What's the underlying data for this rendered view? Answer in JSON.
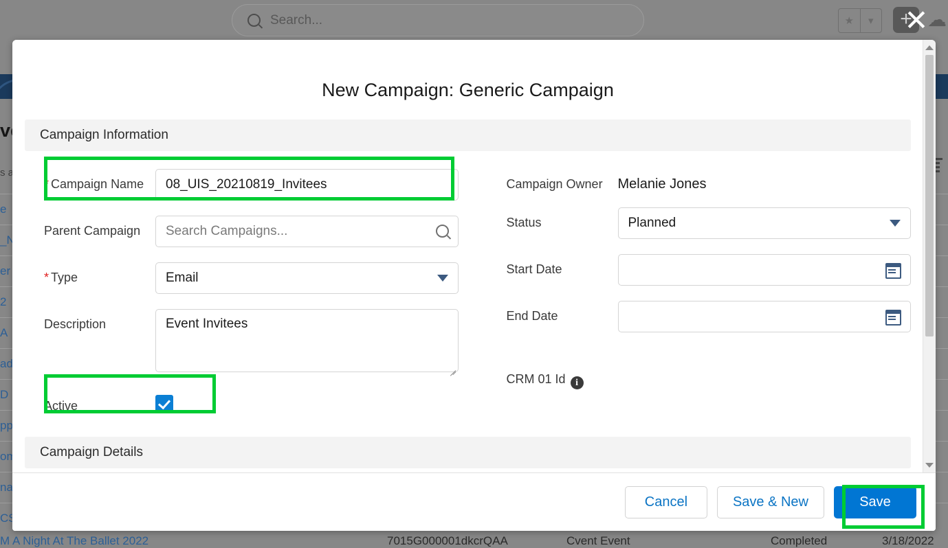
{
  "background": {
    "search": {
      "placeholder": "Search...",
      "icon": "search-icon"
    },
    "favorites": {
      "star_icon": "star-icon",
      "caret_icon": "chevron-down-icon"
    },
    "plus_icon": "plus-icon",
    "cloud_icon": "cloud-icon",
    "close_icon": "close-icon",
    "page_title_fragment": "ve",
    "subtitle_fragment": "s a",
    "row_fragments": [
      "e",
      "_N",
      "er",
      "2",
      "A",
      "ad",
      "D",
      "pp",
      "om",
      "na",
      "CS"
    ],
    "bottom_row": {
      "name": "M A Night At The Ballet 2022",
      "id": "7015G000001dkcrQAA",
      "type": "Cvent Event",
      "status": "Completed",
      "date": "3/18/2022"
    },
    "list_icon": "list-view-icon"
  },
  "modal": {
    "title": "New Campaign: Generic Campaign",
    "sections": [
      {
        "label": "Campaign Information"
      },
      {
        "label": "Campaign Details"
      }
    ],
    "fields": {
      "campaign_name": {
        "label": "Campaign Name",
        "required": true,
        "value": "08_UIS_20210819_Invitees",
        "placeholder": ""
      },
      "parent_campaign": {
        "label": "Parent Campaign",
        "required": false,
        "value": "",
        "placeholder": "Search Campaigns...",
        "icon": "search-icon"
      },
      "type": {
        "label": "Type",
        "required": true,
        "value": "Email",
        "icon": "chevron-down-icon"
      },
      "description": {
        "label": "Description",
        "required": false,
        "value": "Event Invitees",
        "placeholder": ""
      },
      "active": {
        "label": "Active",
        "checked": true
      },
      "campaign_owner": {
        "label": "Campaign Owner",
        "value": "Melanie Jones"
      },
      "status": {
        "label": "Status",
        "value": "Planned",
        "icon": "chevron-down-icon"
      },
      "start_date": {
        "label": "Start Date",
        "value": "",
        "placeholder": "",
        "icon": "calendar-icon"
      },
      "end_date": {
        "label": "End Date",
        "value": "",
        "placeholder": "",
        "icon": "calendar-icon"
      },
      "crm_01_id": {
        "label": "CRM 01 Id",
        "info_icon": "info-icon"
      }
    },
    "footer": {
      "cancel_label": "Cancel",
      "save_new_label": "Save & New",
      "save_label": "Save"
    },
    "scrollbar": {
      "up_icon": "scroll-up-arrow-icon",
      "down_icon": "scroll-down-arrow-icon"
    }
  },
  "colors": {
    "accent_blue": "#0176d3",
    "link_blue": "#0b74c4",
    "highlight_green": "#00cc33",
    "checkbox_blue": "#0b7fd4",
    "required_red": "#e02020",
    "section_bg": "#f3f3f3",
    "overlay_grey": "#878787"
  }
}
